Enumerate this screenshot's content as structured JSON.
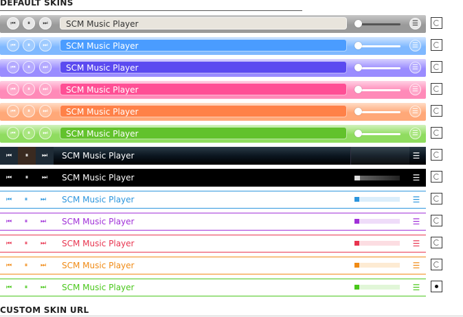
{
  "headings": {
    "default_skins": "DEFAULT SKINS",
    "custom_skin_url": "CUSTOM SKIN URL"
  },
  "icons": {
    "prev": "prev-icon",
    "pause": "pause-icon",
    "next": "next-icon",
    "playlist": "playlist-icon"
  },
  "glyphs": {
    "prev": "⏮",
    "pause": "⏸",
    "next": "⏭",
    "playlist": "☰"
  },
  "skins": [
    {
      "id": "silver",
      "style": "glossy",
      "title": "SCM Music Player",
      "selected": false,
      "colors": {
        "bg": "#9a9a9a",
        "bg_light": "#c7c7c7",
        "title_bg": "#e8e4dc",
        "title_text": "#333333",
        "btn_bg": "#e6e6e6",
        "btn_icon": "#333333",
        "vol": "#555555"
      }
    },
    {
      "id": "blue",
      "style": "glossy",
      "title": "SCM Music Player",
      "selected": false,
      "colors": {
        "bg": "#7fb8ff",
        "bg_light": "#cfe4ff",
        "title_bg": "#4a9cff",
        "title_text": "#ffffff",
        "btn_bg": "#9fcbff",
        "btn_icon": "#ffffff",
        "vol": "#ffffff"
      }
    },
    {
      "id": "purple",
      "style": "glossy",
      "title": "SCM Music Player",
      "selected": false,
      "colors": {
        "bg": "#9a8cff",
        "bg_light": "#d6d0ff",
        "title_bg": "#5b4af0",
        "title_text": "#ffffff",
        "btn_bg": "#b4aaff",
        "btn_icon": "#ffffff",
        "vol": "#ffffff"
      }
    },
    {
      "id": "pink",
      "style": "glossy",
      "title": "SCM Music Player",
      "selected": false,
      "colors": {
        "bg": "#ff8ab8",
        "bg_light": "#ffd0e3",
        "title_bg": "#ff4f95",
        "title_text": "#ffffff",
        "btn_bg": "#ffa8ca",
        "btn_icon": "#ffffff",
        "vol": "#ffffff"
      }
    },
    {
      "id": "orange",
      "style": "glossy",
      "title": "SCM Music Player",
      "selected": false,
      "colors": {
        "bg": "#ffa878",
        "bg_light": "#ffdcc6",
        "title_bg": "#ff8148",
        "title_text": "#ffffff",
        "btn_bg": "#ffc09c",
        "btn_icon": "#ffffff",
        "vol": "#ffffff"
      }
    },
    {
      "id": "green",
      "style": "glossy",
      "title": "SCM Music Player",
      "selected": false,
      "colors": {
        "bg": "#8fdc5f",
        "bg_light": "#d2f2bd",
        "title_bg": "#62c22c",
        "title_text": "#ffffff",
        "btn_bg": "#a9e680",
        "btn_icon": "#ffffff",
        "vol": "#ffffff"
      }
    },
    {
      "id": "black-glass",
      "style": "dark-glass",
      "title": "SCM Music Player",
      "selected": false,
      "colors": {
        "bg": "#0b1620",
        "bg_light": "#2a3a46",
        "title_text": "#ffffff",
        "btn_bg": "#1e2b36",
        "btn_icon": "#ffffff",
        "vol": "#3a4a56"
      }
    },
    {
      "id": "black",
      "style": "dark",
      "title": "SCM Music Player",
      "selected": false,
      "colors": {
        "bg": "#000000",
        "title_text": "#ffffff",
        "btn_icon": "#ffffff",
        "vol": "#666666"
      }
    },
    {
      "id": "flat-blue",
      "style": "flat",
      "title": "SCM Music Player",
      "selected": false,
      "colors": {
        "accent": "#2b95dd",
        "track": "#dbeefb",
        "text": "#2b95dd"
      }
    },
    {
      "id": "flat-purple",
      "style": "flat",
      "title": "SCM Music Player",
      "selected": false,
      "colors": {
        "accent": "#a030d8",
        "track": "#efdcf9",
        "text": "#a030d8"
      }
    },
    {
      "id": "flat-red",
      "style": "flat",
      "title": "SCM Music Player",
      "selected": false,
      "colors": {
        "accent": "#e8344f",
        "track": "#fcdde2",
        "text": "#e8344f"
      }
    },
    {
      "id": "flat-orange",
      "style": "flat",
      "title": "SCM Music Player",
      "selected": false,
      "colors": {
        "accent": "#f08a14",
        "track": "#fdebd3",
        "text": "#f08a14"
      }
    },
    {
      "id": "flat-green",
      "style": "flat",
      "title": "SCM Music Player",
      "selected": true,
      "colors": {
        "accent": "#49c71a",
        "track": "#e1f6d8",
        "text": "#49c71a"
      }
    }
  ]
}
